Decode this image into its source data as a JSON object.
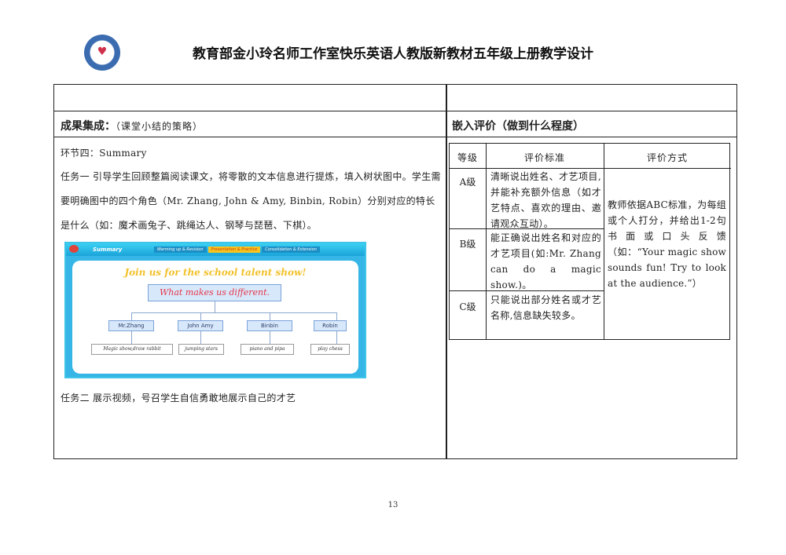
{
  "header": {
    "logo_text": "教育部金小玲名师工作室",
    "title": "教育部金小玲名师工作室快乐英语人教版新教材五年级上册教学设计"
  },
  "left": {
    "section_title": "成果集成：",
    "section_hint": "（课堂小结的策略）",
    "step_title": "环节四：Summary",
    "task1": "任务一 引导学生回顾整篇阅读课文，将零散的文本信息进行提炼，填入树状图中。学生需要明确图中的四个角色（Mr. Zhang, John & Amy, Binbin, Robin）分别对应的特长是什么（如：魔术画兔子、跳绳达人、钢琴与琵琶、下棋）。",
    "task2": "任务二 展示视频，号召学生自信勇敢地展示自己的才艺"
  },
  "slide": {
    "section_name": "Summary",
    "tabs": [
      "Warming up & Revision",
      "Presentation & Practice",
      "Consolidation & Extension"
    ],
    "active_tab": 1,
    "headline": "Join us for the school talent show!",
    "root": "What makes us different.",
    "names": [
      "Mr.Zhang",
      "John    Amy",
      "Binbin",
      "Robin"
    ],
    "skills": [
      "Magic show,draw rabbit",
      "jumping stars",
      "piano and pipa",
      "play chess"
    ]
  },
  "right": {
    "section_title": "嵌入评价（做到什么程度）",
    "table": {
      "headers": [
        "等级",
        "评价标准",
        "评价方式"
      ],
      "rows": [
        {
          "grade": "A级",
          "criteria": "清晰说出姓名、才艺项目,并能补充额外信息（如才艺特点、喜欢的理由、邀请观众互动）。"
        },
        {
          "grade": "B级",
          "criteria": "能正确说出姓名和对应的才艺项目(如:Mr. Zhang can do a magic show.)。"
        },
        {
          "grade": "C级",
          "criteria": "只能说出部分姓名或才艺名称,信息缺失较多。"
        }
      ],
      "method": "教师依据ABC标准，为每组或个人打分，并给出1-2句书面或口头反馈（如：“Your magic show sounds fun! Try to look at the audience.”）"
    }
  },
  "footer": {
    "page_number": "13"
  },
  "colors": {
    "slide_blue": "#35b6e6",
    "headline_gold": "#f2c12b",
    "root_red": "#e5364a"
  }
}
